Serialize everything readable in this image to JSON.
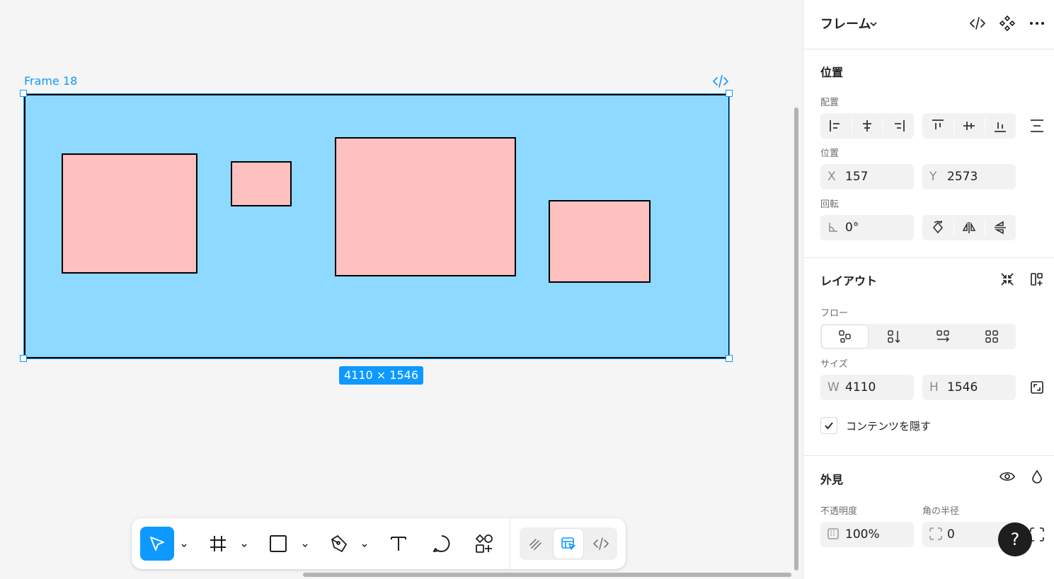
{
  "canvas": {
    "frame_name": "Frame 18",
    "size_badge": "4110 × 1546"
  },
  "colors": {
    "frame_fill": "#8ed9ff",
    "shape_fill": "#ffc0c0",
    "selection": "#0d99ff"
  },
  "toolbar": {
    "tools": [
      "move-tool",
      "frame-tool",
      "rectangle-tool",
      "pen-tool",
      "text-tool",
      "comment-tool",
      "actions-tool"
    ],
    "modes": [
      "draw-mode",
      "design-mode",
      "dev-mode"
    ],
    "active_tool": "move-tool",
    "active_mode": "design-mode"
  },
  "panel": {
    "header": {
      "title": "フレーム"
    },
    "position": {
      "title": "位置",
      "align_label": "配置",
      "position_label": "位置",
      "x_prefix": "X",
      "x_value": "157",
      "y_prefix": "Y",
      "y_value": "2573",
      "rotation_label": "回転",
      "rotation_value": "0°"
    },
    "layout": {
      "title": "レイアウト",
      "flow_label": "フロー",
      "size_label": "サイズ",
      "w_prefix": "W",
      "w_value": "4110",
      "h_prefix": "H",
      "h_value": "1546",
      "clip_label": "コンテンツを隠す",
      "clip_checked": true
    },
    "appearance": {
      "title": "外見",
      "opacity_label": "不透明度",
      "opacity_value": "100%",
      "radius_label": "角の半径",
      "radius_value": "0"
    }
  },
  "help": {
    "label": "?"
  }
}
